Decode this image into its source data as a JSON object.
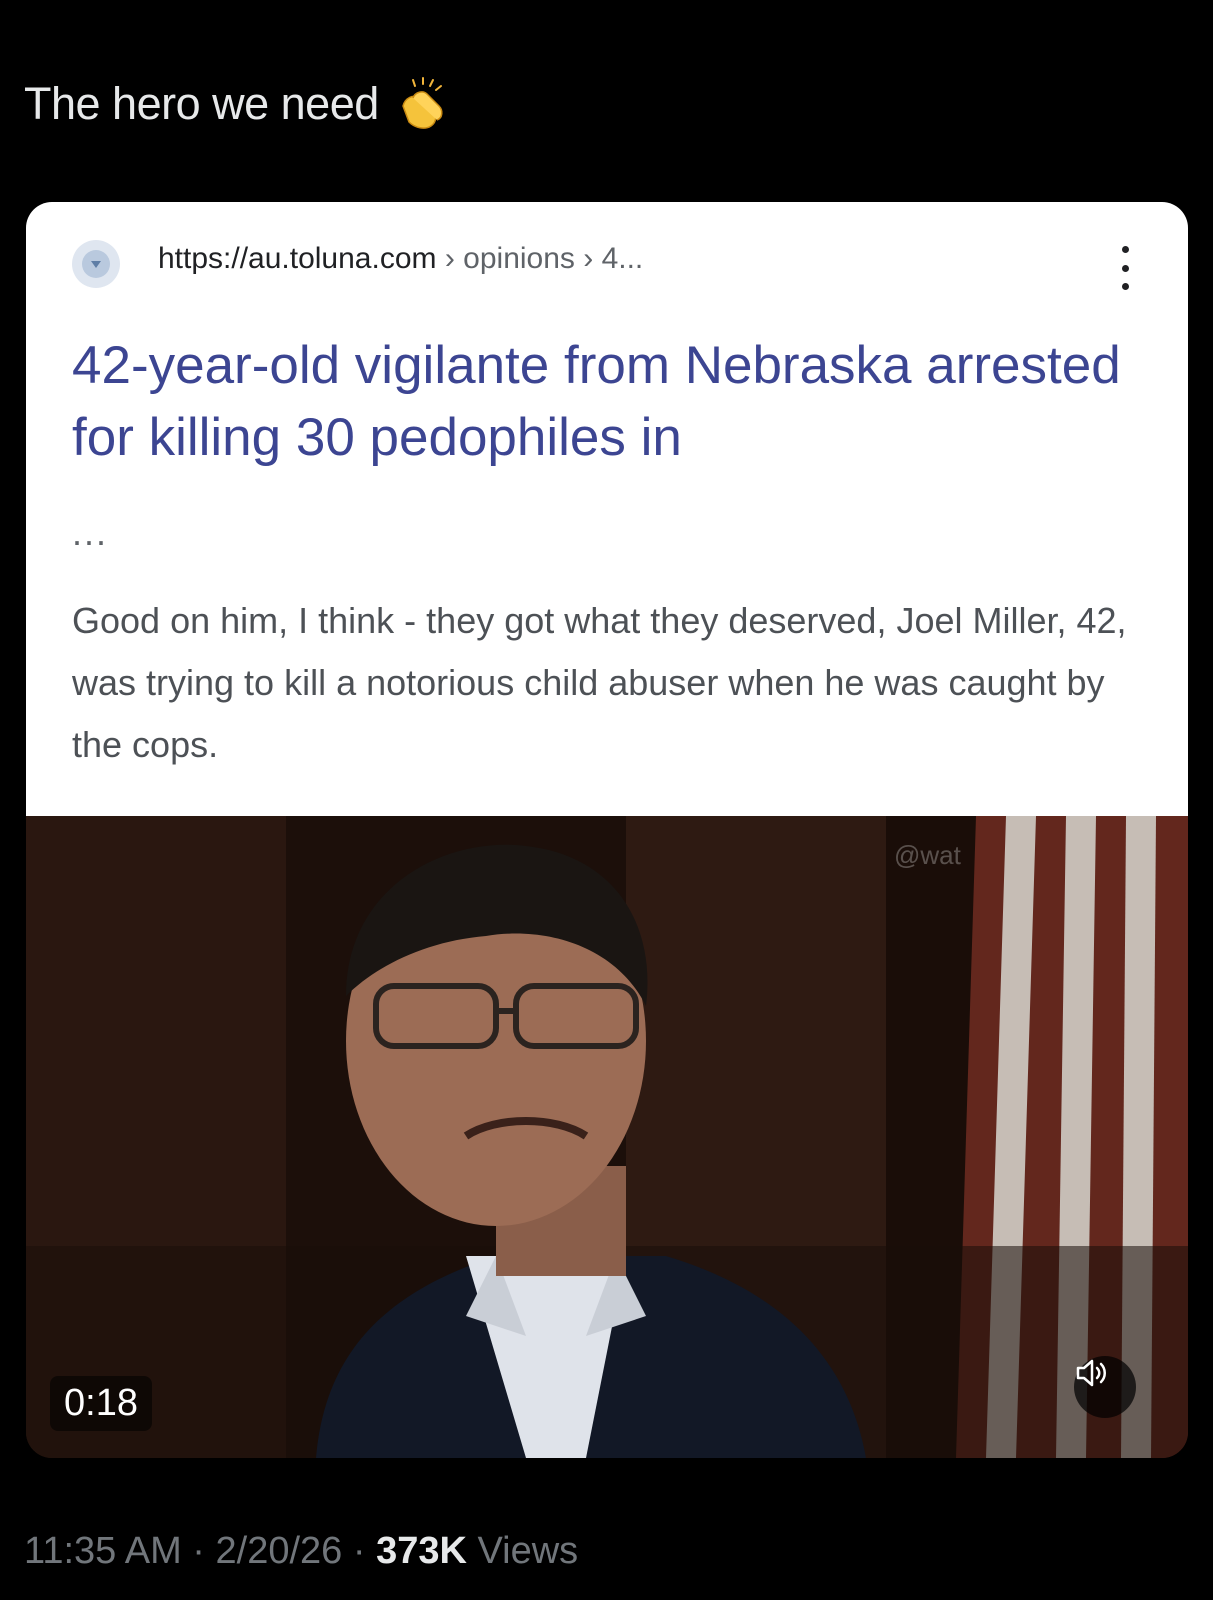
{
  "post": {
    "text": "The hero we need",
    "emoji_icon": "clapping-hands-icon"
  },
  "search_result": {
    "site_url": "https://au.toluna.com",
    "breadcrumb": "› opinions › 4...",
    "title": "42-year-old vigilante from Nebraska arrested for killing 30 pedophiles in",
    "title_ellipsis": "...",
    "snippet": "Good on him, I think - they got what they deserved, Joel Miller, 42, was trying to kill a notorious child abuser when he was caught by the cops.",
    "menu_icon": "kebab-menu-icon",
    "favicon_icon": "site-favicon-icon"
  },
  "video": {
    "duration": "0:18",
    "watermark": "@wat",
    "mute_icon": "speaker-icon"
  },
  "meta": {
    "time": "11:35 AM",
    "separator": "·",
    "date": "2/20/26",
    "views_count": "373K",
    "views_label": "Views"
  },
  "colors": {
    "background": "#000000",
    "primary_text": "#e7e9ea",
    "secondary_text": "#71767b",
    "link_title": "#3c4592",
    "snippet_text": "#4d5156"
  }
}
